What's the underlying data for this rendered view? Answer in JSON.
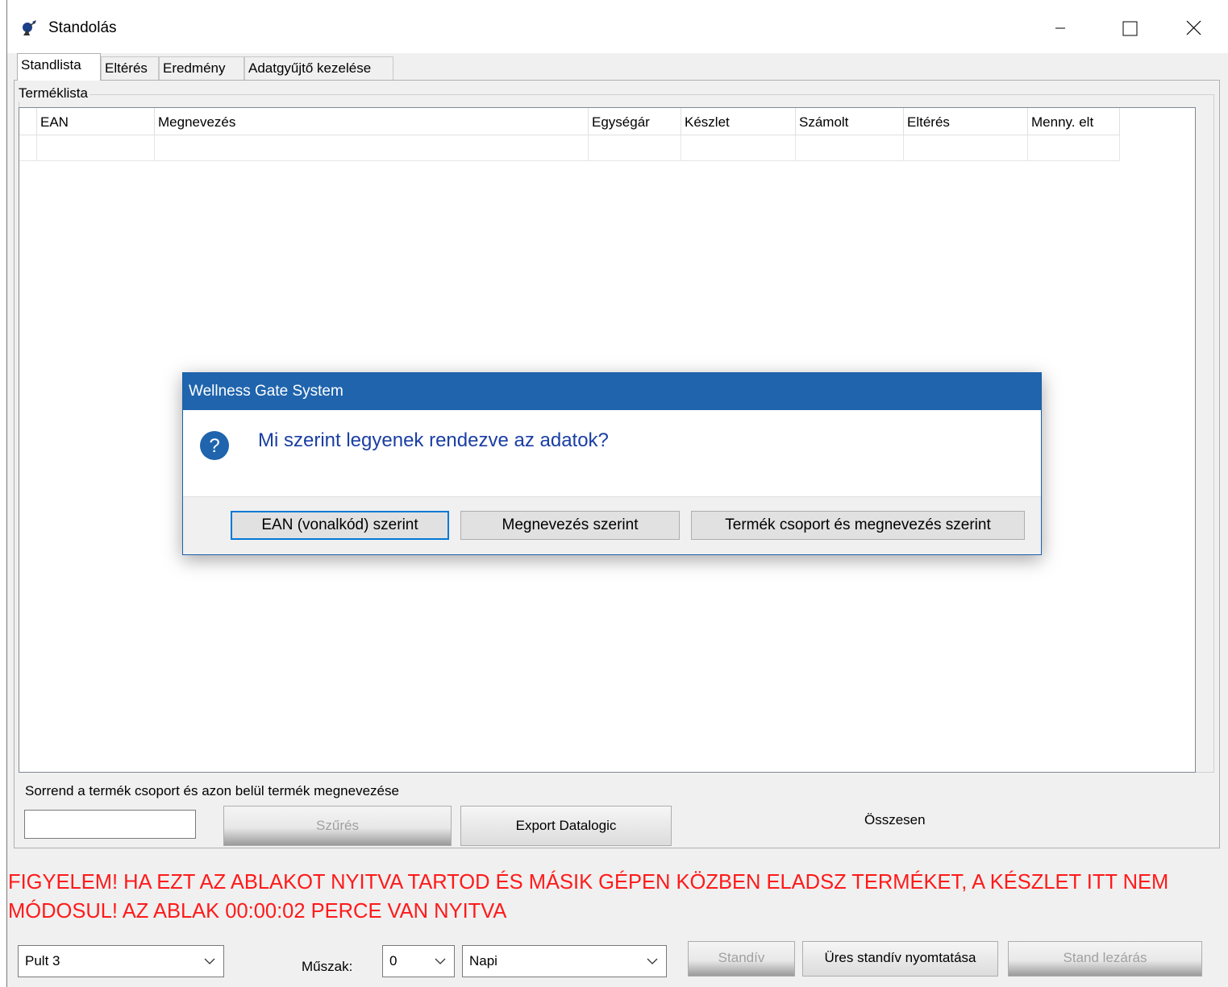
{
  "window": {
    "title": "Standolás"
  },
  "tabs": [
    {
      "label": "Standlista",
      "active": true
    },
    {
      "label": "Eltérés",
      "active": false
    },
    {
      "label": "Eredmény",
      "active": false
    },
    {
      "label": "Adatgyűjtő kezelése",
      "active": false
    }
  ],
  "product_list": {
    "group_label": "Terméklista",
    "columns": [
      "EAN",
      "Megnevezés",
      "Egységár",
      "Készlet",
      "Számolt",
      "Eltérés",
      "Menny. elt"
    ]
  },
  "sort_text": "Sorrend a termék csoport és azon belül termék megnevezése",
  "filter": {
    "value": "",
    "button": "Szűrés"
  },
  "export_button": "Export Datalogic",
  "summary_label": "Összesen",
  "warning": "FIGYELEM! HA EZT AZ ABLAKOT NYITVA TARTOD ÉS MÁSIK GÉPEN KÖZBEN ELADSZ TERMÉKET, A KÉSZLET ITT NEM MÓDOSUL! AZ ABLAK 00:00:02 PERCE VAN NYITVA",
  "bottom": {
    "counter_select": "Pult 3",
    "shift_label": "Műszak:",
    "shift_select": "0",
    "period_select": "Napi",
    "standiv_button": "Standív",
    "empty_print_button": "Üres standív nyomtatása",
    "close_button": "Stand lezárás"
  },
  "dialog": {
    "title": "Wellness Gate System",
    "message": "Mi szerint legyenek rendezve az adatok?",
    "buttons": [
      "EAN (vonalkód) szerint",
      "Megnevezés szerint",
      "Termék csoport és megnevezés szerint"
    ]
  },
  "colors": {
    "warning": "#ff1a1a",
    "dialog_title_bg": "#1f64ad",
    "dialog_message": "#1a3ea3",
    "focus_border": "#0078d7"
  }
}
